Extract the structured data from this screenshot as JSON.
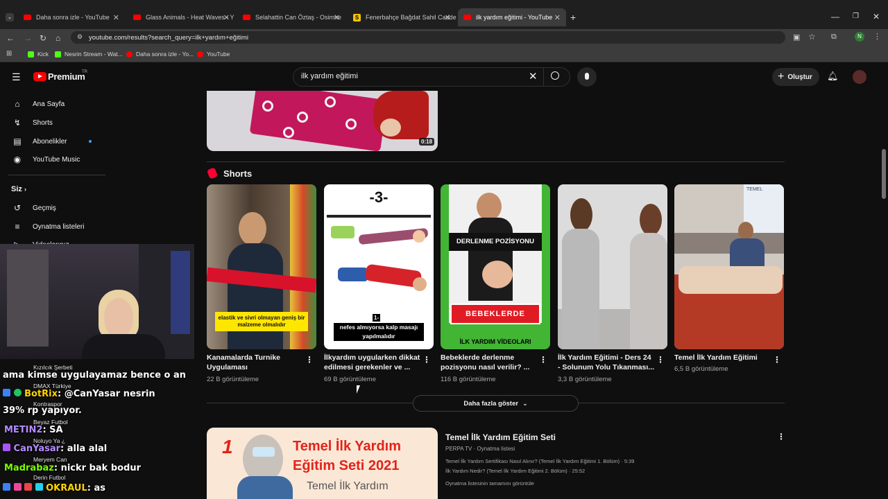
{
  "browser": {
    "tabs": [
      {
        "label": "Daha sonra izle - YouTube",
        "icon": "youtube-favicon"
      },
      {
        "label": "Glass Animals - Heat Waves - Y",
        "icon": "youtube-favicon"
      },
      {
        "label": "Selahattin Can Öztaş - Osimhe",
        "icon": "youtube-favicon"
      },
      {
        "label": "Fenerbahçe Bağdat Sahil Cadde",
        "icon": "s-favicon"
      },
      {
        "label": "ilk yardım eğitimi - YouTube",
        "icon": "youtube-favicon"
      }
    ],
    "url": "youtube.com/results?search_query=ilk+yardım+eğitimi",
    "profile_initial": "N",
    "bookmarks": [
      {
        "label": "Kick",
        "color": "#53fc18"
      },
      {
        "label": "Nesrin Stream - Wat...",
        "color": "#53fc18"
      },
      {
        "label": "Daha sonra izle - Yo...",
        "color": "#ff0000"
      },
      {
        "label": "YouTube",
        "color": "#ff0000"
      }
    ]
  },
  "youtube": {
    "logo": "Premium",
    "logo_sup": "TR",
    "search_value": "ilk yardım eğitimi",
    "create_label": "Oluştur",
    "sidebar": {
      "items": [
        {
          "label": "Ana Sayfa",
          "icon": "home-icon"
        },
        {
          "label": "Shorts",
          "icon": "shorts-icon"
        },
        {
          "label": "Abonelikler",
          "icon": "subscriptions-icon"
        },
        {
          "label": "YouTube Music",
          "icon": "music-icon"
        }
      ],
      "section_label": "Siz",
      "section_items": [
        {
          "label": "Geçmiş",
          "icon": "history-icon"
        },
        {
          "label": "Oynatma listeleri",
          "icon": "playlists-icon"
        },
        {
          "label": "Videolarınız",
          "icon": "your-videos-icon"
        }
      ]
    },
    "top_video_duration": "0:18",
    "shorts_heading": "Shorts",
    "shorts": [
      {
        "title1": "Kanamalarda Turnike",
        "title2": "Uygulaması",
        "views": "22 B görüntüleme",
        "caption": "elastik ve sivri olmayan geniş bir malzeme olmalıdır"
      },
      {
        "title1": "İlkyardım uygularken dikkat",
        "title2": "edilmesi gerekenler ve ...",
        "views": "69 B görüntüleme",
        "badge": "-3-",
        "caption_num": "1-",
        "caption": "nefes almıyorsa kalp masajı yapılmalıdır"
      },
      {
        "title1": "Bebeklerde derlenme",
        "title2": "pozisyonu nasıl verilir? ...",
        "views": "116 B görüntüleme",
        "banner": "DERLENME POZİSYONU",
        "bottom": "BEBEKLERDE",
        "footer": "İLK YARDIM VİDEOLARI"
      },
      {
        "title1": "İlk Yardım Eğitimi - Ders 24",
        "title2": "- Solunum Yolu Tıkanması...",
        "views": "3,3 B görüntüleme"
      },
      {
        "title1": "Temel İlk Yardım Eğitimi",
        "title2": "",
        "views": "6,5 B görüntüleme",
        "slide_text": "TEMEL"
      }
    ],
    "show_more": "Daha fazla göster",
    "playlist": {
      "title": "Temel İlk Yardım Eğitim Seti",
      "channel": "PERPA TV",
      "type": "Oynatma listesi",
      "items": [
        {
          "text": "Temel İlk Yardım Sertifikası Nasıl Alınır? (Temel İlk Yardım Eğitimi 1. Bölüm)",
          "duration": "5:39"
        },
        {
          "text": "İlk Yardım Nedir? (Temel İlk Yardım Eğitimi 2. Bölüm)",
          "duration": "25:52"
        }
      ],
      "view_all": "Oynatma listesinin tamamını görüntüle",
      "thumb_num": "1",
      "thumb_title1": "Temel İlk Yardım",
      "thumb_title2": "Eğitim Seti 2021",
      "thumb_sub": "Temel İlk Yardım"
    }
  },
  "chat": [
    {
      "kind": "name",
      "text": "Kızılcık Şerbeti"
    },
    {
      "kind": "msg",
      "text": "ama kimse uygulayamaz bence o an"
    },
    {
      "kind": "name",
      "text": "DMAX Türkiye"
    },
    {
      "kind": "user",
      "user": "BotRix",
      "color": "#ffd400",
      "text": ": @CanYasar nesrin"
    },
    {
      "kind": "name",
      "text": "Kontraspor"
    },
    {
      "kind": "msg",
      "text": "39% rp yapıyor."
    },
    {
      "kind": "name",
      "text": "Beyaz Futbol"
    },
    {
      "kind": "user",
      "user": "METIN2",
      "color": "#b58cff",
      "text": ":  SA"
    },
    {
      "kind": "name",
      "text": "Noluyo Ya ¿"
    },
    {
      "kind": "user",
      "user": "CanYasar",
      "color": "#b58cff",
      "text": ": alla alal"
    },
    {
      "kind": "name",
      "text": "Meryem Can"
    },
    {
      "kind": "user",
      "user": "Madrabaz",
      "color": "#7cfc00",
      "text": ": nickr bak bodur"
    },
    {
      "kind": "name",
      "text": "Derin Futbol"
    },
    {
      "kind": "user",
      "user": "OKRAUL",
      "color": "#ffd400",
      "text": ": as"
    }
  ]
}
